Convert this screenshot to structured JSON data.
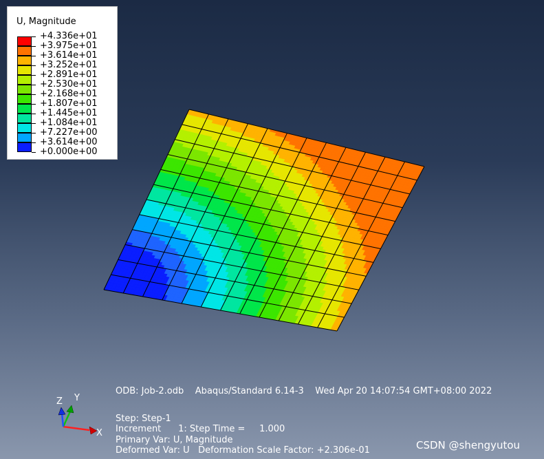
{
  "legend": {
    "title": "U, Magnitude",
    "entries": [
      {
        "label": "+4.336e+01",
        "color": "#ff0000"
      },
      {
        "label": "+3.975e+01",
        "color": "#ff7300"
      },
      {
        "label": "+3.614e+01",
        "color": "#ffb300"
      },
      {
        "label": "+3.252e+01",
        "color": "#e6e600"
      },
      {
        "label": "+2.891e+01",
        "color": "#b4f000"
      },
      {
        "label": "+2.530e+01",
        "color": "#7ce600"
      },
      {
        "label": "+2.168e+01",
        "color": "#3ce600"
      },
      {
        "label": "+1.807e+01",
        "color": "#00e64a"
      },
      {
        "label": "+1.445e+01",
        "color": "#00e6a0"
      },
      {
        "label": "+1.084e+01",
        "color": "#00e6e6"
      },
      {
        "label": "+7.227e+00",
        "color": "#00a6ff"
      },
      {
        "label": "+3.614e+00",
        "color": "#1e64ff"
      },
      {
        "label": "+0.000e+00",
        "color": "#0a1eff"
      }
    ]
  },
  "info": {
    "odb_line": "ODB: Job-2.odb    Abaqus/Standard 6.14-3    Wed Apr 20 14:07:54 GMT+08:00 2022",
    "step_line": "Step: Step-1",
    "increment_line": "Increment      1: Step Time =     1.000",
    "primary_var_line": "Primary Var: U, Magnitude",
    "deformed_var_line": "Deformed Var: U   Deformation Scale Factor: +2.306e-01"
  },
  "triad": {
    "x_label": "X",
    "y_label": "Y",
    "z_label": "Z"
  },
  "watermark": "CSDN @shengyutou",
  "mesh": {
    "divisions": 12
  }
}
